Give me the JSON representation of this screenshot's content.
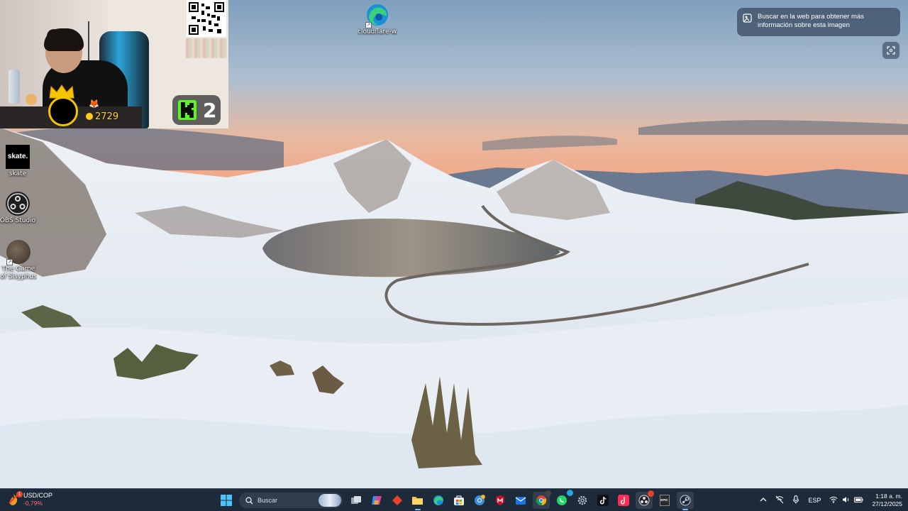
{
  "desktop": {
    "icons": [
      {
        "label": "cloudflare-w...",
        "icon": "edge-icon"
      },
      {
        "label": "skate",
        "icon": "skate-icon",
        "glyph_text": "skate."
      },
      {
        "label": "OBS Studio",
        "icon": "obs-icon"
      },
      {
        "label": "The Game of Sisyphus",
        "icon": "sisyphus-icon"
      }
    ]
  },
  "stream_overlay": {
    "coins": "2729",
    "kick_viewers": "2"
  },
  "lens": {
    "prompt": "Buscar en la web para obtener más información sobre esta imagen"
  },
  "taskbar": {
    "widget": {
      "title": "USD/COP",
      "value": "-0,79%",
      "icon": "currency-flame-icon",
      "badge": "1"
    },
    "search_placeholder": "Buscar",
    "apps": [
      {
        "name": "task-view",
        "icon": "task-view-icon"
      },
      {
        "name": "copilot",
        "icon": "copilot-icon"
      },
      {
        "name": "git-app",
        "icon": "diamond-app-icon"
      },
      {
        "name": "file-explorer",
        "icon": "folder-icon"
      },
      {
        "name": "edge",
        "icon": "edge-icon"
      },
      {
        "name": "microsoft-store",
        "icon": "store-icon"
      },
      {
        "name": "chrome-canary",
        "icon": "browser-icon"
      },
      {
        "name": "mcafee",
        "icon": "shield-m-icon"
      },
      {
        "name": "mail",
        "icon": "mail-icon"
      },
      {
        "name": "chrome",
        "icon": "chrome-icon"
      },
      {
        "name": "whatsapp",
        "icon": "whatsapp-icon"
      },
      {
        "name": "settings",
        "icon": "gear-icon"
      },
      {
        "name": "tiktok",
        "icon": "tiktok-icon"
      },
      {
        "name": "tiktok-live",
        "icon": "tiktok-live-icon"
      },
      {
        "name": "obs",
        "icon": "obs-icon"
      },
      {
        "name": "epic-games",
        "icon": "epic-icon",
        "glyph_text": "EPIC"
      },
      {
        "name": "steam",
        "icon": "steam-icon"
      }
    ],
    "tray": {
      "language": "ESP",
      "time": "1:18 a. m.",
      "date": "27/12/2025"
    }
  },
  "colors": {
    "taskbar_bg": "#1c2a3a",
    "accent": "#7fb8ff",
    "widget_negative": "#ff6b6b",
    "kick_green": "#53fc18"
  }
}
